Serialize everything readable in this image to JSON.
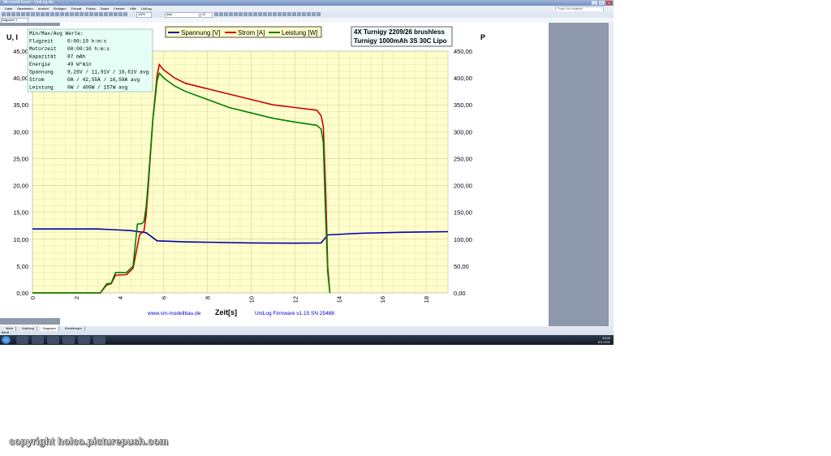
{
  "window": {
    "title": "Microsoft Excel - UniLog.xls",
    "controls": [
      "_",
      "□",
      "X"
    ]
  },
  "menu": [
    "Datei",
    "Bearbeiten",
    "Ansicht",
    "Einfügen",
    "Format",
    "Extras",
    "Daten",
    "Fenster",
    "Hilfe",
    "UniLog"
  ],
  "help_placeholder": "Frage hier eingeben",
  "toolbar": {
    "font": "Arial",
    "size": "10",
    "zoom": "100%"
  },
  "namebox": "Diagramm 1",
  "statusbar": "Bereit",
  "sheet_tabs": [
    "Werte",
    "Anleitung",
    "Diagramm",
    "Einstellungen"
  ],
  "taskbar": {
    "time": "12:02",
    "date": "8.5.2011"
  },
  "stats": {
    "header": "Min/Max/Avg Werte:",
    "rows": [
      {
        "label": "Flugzeit",
        "value": "0:00:19 h:m:s"
      },
      {
        "label": "Motorzeit",
        "value": "00:00:10 h:m:s"
      },
      {
        "label": "Kapazität",
        "value": "87 mAh"
      },
      {
        "label": "Energie",
        "value": "49 W*min"
      },
      {
        "label": "Spannung",
        "value": "9,26V / 11,91V / 10,61V avg"
      },
      {
        "label": "Strom",
        "value": "0A / 42,55A / 16,58A avg"
      },
      {
        "label": "Leistung",
        "value": "0W / 409W / 157W avg"
      }
    ]
  },
  "copyright": "copyright holco.picturepush.com",
  "chart_data": {
    "type": "line",
    "title": [
      "4X Turnigy 2209/26 brushless",
      "Turnigy 1000mAh 3S 30C Lipo"
    ],
    "xlabel": "Zeit[s]",
    "ylabel_left": "U, I",
    "ylabel_right": "P",
    "footer_left": "www.sm-modellbau.de",
    "footer_right": "UniLog Firmware v1.15 SN 25488",
    "xlim": [
      0,
      19
    ],
    "xticks": [
      "0",
      "2",
      "4",
      "6",
      "8",
      "10",
      "12",
      "14",
      "16",
      "18"
    ],
    "ylim_left": [
      0,
      45
    ],
    "ylim_right": [
      0,
      450
    ],
    "yticks_left": [
      "0,00",
      "5,00",
      "10,00",
      "15,00",
      "20,00",
      "25,00",
      "30,00",
      "35,00",
      "40,00",
      "45,00"
    ],
    "yticks_right": [
      "0,00",
      "50,00",
      "100,00",
      "150,00",
      "200,00",
      "250,00",
      "300,00",
      "350,00",
      "400,00",
      "450,00"
    ],
    "grid": true,
    "legend": "top-center",
    "background": "#ffffcc",
    "series": [
      {
        "name": "Spannung [V]",
        "color": "#0000aa",
        "axis": "left",
        "points": [
          [
            0,
            11.9
          ],
          [
            3,
            11.9
          ],
          [
            4,
            11.7
          ],
          [
            4.5,
            11.6
          ],
          [
            5.2,
            11.2
          ],
          [
            5.7,
            9.7
          ],
          [
            7,
            9.5
          ],
          [
            10,
            9.3
          ],
          [
            12,
            9.25
          ],
          [
            13.2,
            9.3
          ],
          [
            13.5,
            10.8
          ],
          [
            15,
            11.1
          ],
          [
            17,
            11.3
          ],
          [
            19,
            11.4
          ]
        ]
      },
      {
        "name": "Strom [A]",
        "color": "#cc0000",
        "axis": "left",
        "points": [
          [
            0,
            0
          ],
          [
            3.1,
            0
          ],
          [
            3.4,
            1.5
          ],
          [
            3.6,
            1.7
          ],
          [
            3.8,
            3.3
          ],
          [
            4.3,
            3.4
          ],
          [
            4.6,
            4.6
          ],
          [
            4.9,
            10.8
          ],
          [
            5.0,
            11.2
          ],
          [
            5.1,
            11.5
          ],
          [
            5.2,
            14.5
          ],
          [
            5.3,
            20
          ],
          [
            5.5,
            32
          ],
          [
            5.7,
            40.5
          ],
          [
            5.8,
            42.5
          ],
          [
            6.0,
            41.5
          ],
          [
            6.5,
            40
          ],
          [
            7,
            39
          ],
          [
            8,
            38
          ],
          [
            9,
            37
          ],
          [
            10,
            36
          ],
          [
            11,
            35
          ],
          [
            12,
            34.5
          ],
          [
            13,
            34
          ],
          [
            13.2,
            33
          ],
          [
            13.3,
            31
          ],
          [
            13.4,
            20
          ],
          [
            13.5,
            5
          ],
          [
            13.6,
            0
          ]
        ]
      },
      {
        "name": "Leistung [W]",
        "color": "#008000",
        "axis": "right",
        "points": [
          [
            0,
            0
          ],
          [
            3.1,
            0
          ],
          [
            3.4,
            17
          ],
          [
            3.6,
            18
          ],
          [
            3.8,
            38
          ],
          [
            4.3,
            38
          ],
          [
            4.6,
            50
          ],
          [
            4.8,
            128
          ],
          [
            5.0,
            129
          ],
          [
            5.1,
            133
          ],
          [
            5.2,
            160
          ],
          [
            5.3,
            210
          ],
          [
            5.5,
            320
          ],
          [
            5.7,
            395
          ],
          [
            5.8,
            409
          ],
          [
            6.0,
            400
          ],
          [
            6.5,
            385
          ],
          [
            7,
            375
          ],
          [
            8,
            360
          ],
          [
            9,
            345
          ],
          [
            10,
            335
          ],
          [
            11,
            325
          ],
          [
            12,
            318
          ],
          [
            13,
            312
          ],
          [
            13.2,
            305
          ],
          [
            13.3,
            280
          ],
          [
            13.4,
            150
          ],
          [
            13.5,
            40
          ],
          [
            13.6,
            0
          ]
        ]
      }
    ]
  }
}
